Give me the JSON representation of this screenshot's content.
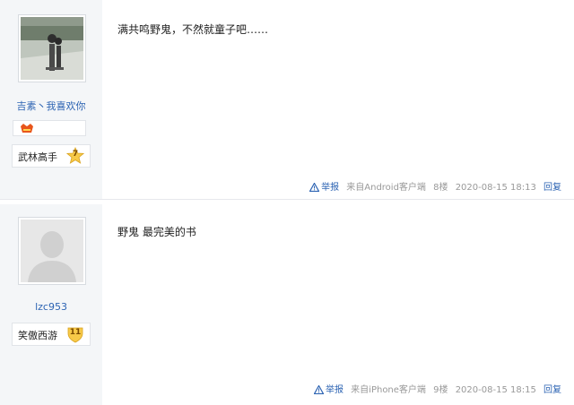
{
  "posts": [
    {
      "username": "吉素丶我喜欢你",
      "level_name": "武林高手",
      "level": "7",
      "content": "满共鸣野鬼，不然就童子吧……",
      "report_label": "举报",
      "source": "来自Android客户端",
      "floor": "8楼",
      "timestamp": "2020-08-15 18:13",
      "reply_label": "回复"
    },
    {
      "username": "lzc953",
      "level_name": "笑傲西游",
      "level": "11",
      "content": "野鬼 最完美的书",
      "report_label": "举报",
      "source": "来自iPhone客户端",
      "floor": "9楼",
      "timestamp": "2020-08-15 18:15",
      "reply_label": "回复"
    }
  ],
  "colors": {
    "link": "#2d64b3",
    "sidebar_bg": "#f4f6f8",
    "meta_text": "#999999",
    "level_badge_fill": "#f7c948"
  },
  "icons": {
    "report": "warning-triangle-icon",
    "avatar_default": "default-avatar-icon",
    "member_badge": "member-badge-icon"
  }
}
